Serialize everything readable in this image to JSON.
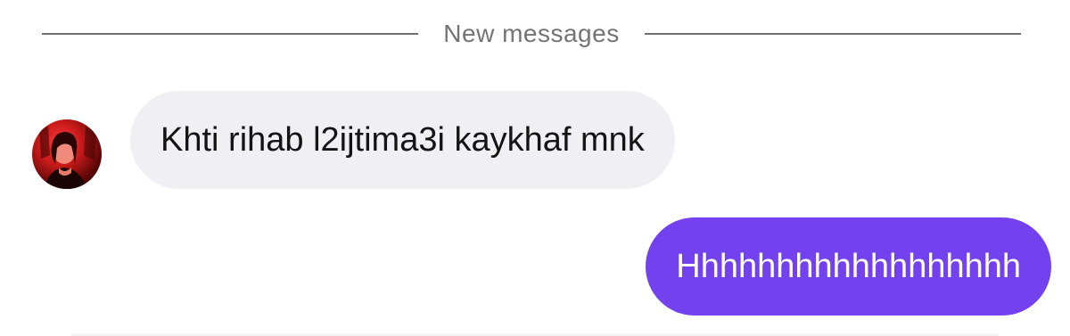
{
  "divider": {
    "label": "New messages"
  },
  "messages": [
    {
      "direction": "incoming",
      "text": "Khti rihab l2ijtima3i kaykhaf mnk",
      "sender_avatar": "avatar-photo"
    },
    {
      "direction": "outgoing",
      "text": "Hhhhhhhhhhhhhhhhhh"
    }
  ],
  "colors": {
    "incoming_bubble": "#efeff4",
    "outgoing_bubble": "#7342ee",
    "divider_text": "#737378",
    "divider_line": "#6f6f73"
  }
}
